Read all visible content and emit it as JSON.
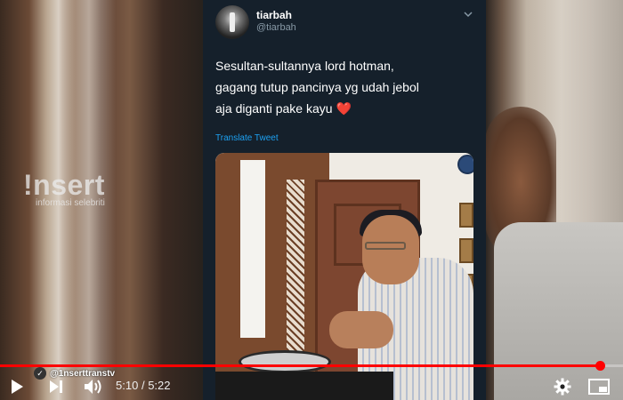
{
  "watermark": {
    "brand": "!nsert",
    "tagline": "informasi selebriti"
  },
  "tweet": {
    "display_name": "tiarbah",
    "handle": "@tiarbah",
    "text_lines": [
      "Sesultan-sultannya lord hotman,",
      "gagang tutup pancinya yg udah jebol",
      "aja diganti pake kayu"
    ],
    "emoji": "❤️",
    "translate_label": "Translate Tweet"
  },
  "player": {
    "channel_handle": "@1nserttranstv",
    "current_time": "5:10",
    "separator": "/",
    "duration": "5:22",
    "progress_fraction": 0.963,
    "accent_color": "#ff0000",
    "icons": [
      "play-icon",
      "next-icon",
      "volume-icon",
      "settings-gear-icon",
      "miniplayer-icon"
    ]
  }
}
